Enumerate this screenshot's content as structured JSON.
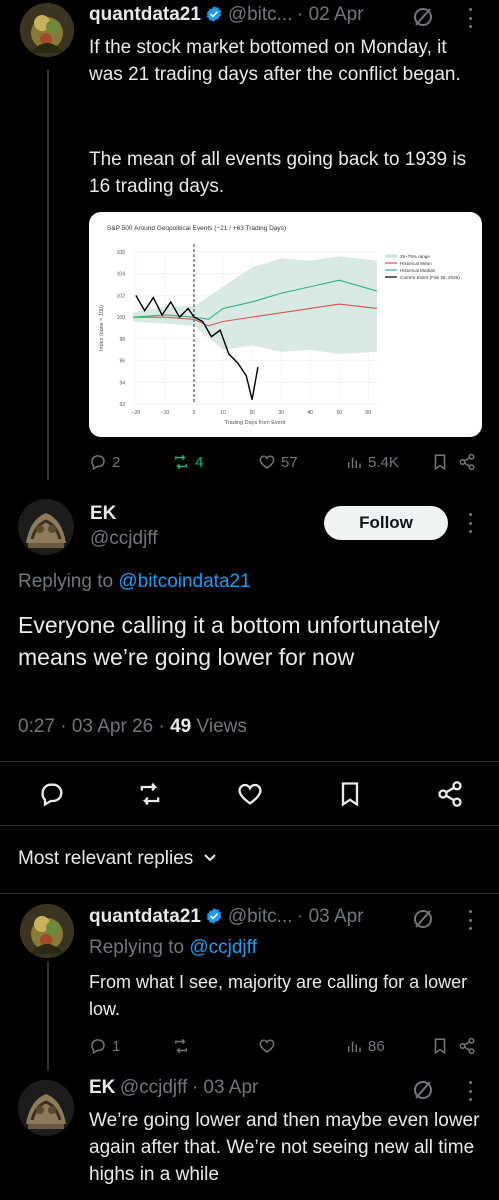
{
  "tweet1": {
    "name": "quantdata21",
    "handle": "@bitc...",
    "date": "· 02 Apr",
    "text_p1": "If the stock market bottomed on Monday, it was 21 trading days after the conflict began.",
    "text_p2": "The mean of all events going back to 1939 is 16 trading days.",
    "replies": "2",
    "reposts": "4",
    "likes": "57",
    "views": "5.4K"
  },
  "chart_data": {
    "type": "line",
    "title": "S&P 500 Around Geopolitical Events (−21 / +63 Trading Days)",
    "xlabel": "Trading Days from Event",
    "ylabel": "Index (base = 100)",
    "xlim": [
      -21,
      63
    ],
    "ylim": [
      92,
      106
    ],
    "x_ticks": [
      "−20",
      "−10",
      "0",
      "10",
      "20",
      "30",
      "40",
      "50",
      "60"
    ],
    "y_ticks": [
      "92",
      "94",
      "96",
      "98",
      "100",
      "102",
      "104",
      "106"
    ],
    "legend_position": "top-right",
    "colors": {
      "band": "#cfe3dc",
      "mean": "#d9534f",
      "median": "#2fb37a",
      "current": "#000000"
    },
    "series": [
      {
        "name": "25–75% range",
        "x": [
          -21,
          -10,
          0,
          10,
          20,
          30,
          40,
          50,
          63
        ],
        "lower": [
          99.6,
          99.4,
          99.2,
          97.0,
          97.4,
          96.8,
          97.0,
          96.6,
          96.8
        ],
        "upper": [
          100.4,
          101.0,
          101.0,
          102.8,
          104.6,
          105.4,
          105.2,
          105.6,
          105.2
        ]
      },
      {
        "name": "Historical Mean",
        "x": [
          -21,
          -10,
          0,
          5,
          10,
          20,
          30,
          40,
          50,
          63
        ],
        "y": [
          100.0,
          100.0,
          99.8,
          99.2,
          99.6,
          100.0,
          100.4,
          100.8,
          101.2,
          100.8
        ]
      },
      {
        "name": "Historical Median",
        "x": [
          -21,
          -10,
          0,
          5,
          10,
          20,
          30,
          40,
          50,
          63
        ],
        "y": [
          100.0,
          100.2,
          100.0,
          99.8,
          100.8,
          101.4,
          102.2,
          102.8,
          103.4,
          102.4
        ]
      },
      {
        "name": "Current Event (Feb 28, 2026)",
        "x": [
          -20,
          -17,
          -14,
          -11,
          -8,
          -5,
          -2,
          0,
          3,
          6,
          9,
          12,
          15,
          18,
          20,
          22
        ],
        "y": [
          102.0,
          100.6,
          101.8,
          100.2,
          101.4,
          100.0,
          100.8,
          100.0,
          99.6,
          98.2,
          98.8,
          96.6,
          95.8,
          94.6,
          92.4,
          95.4
        ]
      }
    ]
  },
  "reply1": {
    "name": "EK",
    "handle": "@ccjdjff",
    "follow": "Follow",
    "replying_to": "Replying to",
    "replying_handle": "@bitcoindata21",
    "text": "Everyone calling it a bottom unfortunately means we’re going lower for now",
    "time": "0:27 · 03 Apr 26 ·",
    "views_count": "49",
    "views_label": "Views"
  },
  "replies_filter": "Most relevant replies",
  "tweet3": {
    "name": "quantdata21",
    "handle": "@bitc...",
    "date": "· 03 Apr",
    "replying_to": "Replying to",
    "replying_handle": "@ccjdjff",
    "text": "From what I see, majority are calling for a lower low.",
    "replies": "1",
    "views": "86"
  },
  "tweet4": {
    "name": "EK",
    "handle": "@ccjdjff",
    "date": "· 03 Apr",
    "text": "We’re going lower and then maybe even lower again after that. We’re not seeing new all time highs in a while"
  }
}
